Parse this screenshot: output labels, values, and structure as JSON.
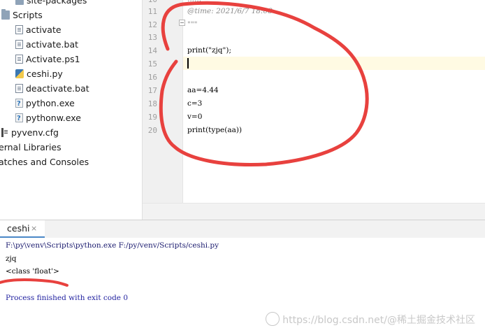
{
  "project_tree": {
    "items": [
      {
        "label": "site-packages",
        "icon": "folder-icon"
      },
      {
        "label": "Scripts",
        "icon": "folder-icon"
      },
      {
        "label": "activate",
        "icon": "file-icon"
      },
      {
        "label": "activate.bat",
        "icon": "file-icon"
      },
      {
        "label": "Activate.ps1",
        "icon": "file-icon"
      },
      {
        "label": "ceshi.py",
        "icon": "python-file-icon"
      },
      {
        "label": "deactivate.bat",
        "icon": "file-icon"
      },
      {
        "label": "python.exe",
        "icon": "executable-icon"
      },
      {
        "label": "pythonw.exe",
        "icon": "executable-icon"
      },
      {
        "label": "pyvenv.cfg",
        "icon": "config-file-icon"
      },
      {
        "label": "ernal Libraries",
        "icon": ""
      },
      {
        "label": "atches and Consoles",
        "icon": ""
      }
    ]
  },
  "editor": {
    "lines": [
      {
        "no": "10",
        "text": "......"
      },
      {
        "no": "11",
        "text": "@time: 2021/6/7 18:08"
      },
      {
        "no": "12",
        "text": "\"\"\""
      },
      {
        "no": "13",
        "text": ""
      },
      {
        "no": "14",
        "text": "print(\"zjq\");"
      },
      {
        "no": "15",
        "text": ""
      },
      {
        "no": "16",
        "text": ""
      },
      {
        "no": "17",
        "text": "aa=4.44"
      },
      {
        "no": "18",
        "text": "c=3"
      },
      {
        "no": "19",
        "text": "v=0"
      },
      {
        "no": "20",
        "text": "print(type(aa))"
      }
    ],
    "current_line": "15"
  },
  "run_panel": {
    "tab_label": "ceshi",
    "close_glyph": "×",
    "output": [
      "F:\\py\\venv\\Scripts\\python.exe F:/py/venv/Scripts/ceshi.py",
      "zjq",
      "<class 'float'>",
      "",
      "Process finished with exit code 0"
    ]
  },
  "watermark": "https://blog.csdn.net/@稀土掘金技术社区",
  "colors": {
    "annotation_red": "#e8413e",
    "tab_underline": "#4a88c7",
    "current_line_bg": "#fffae3",
    "gutter_bg": "#f0f0f0"
  }
}
